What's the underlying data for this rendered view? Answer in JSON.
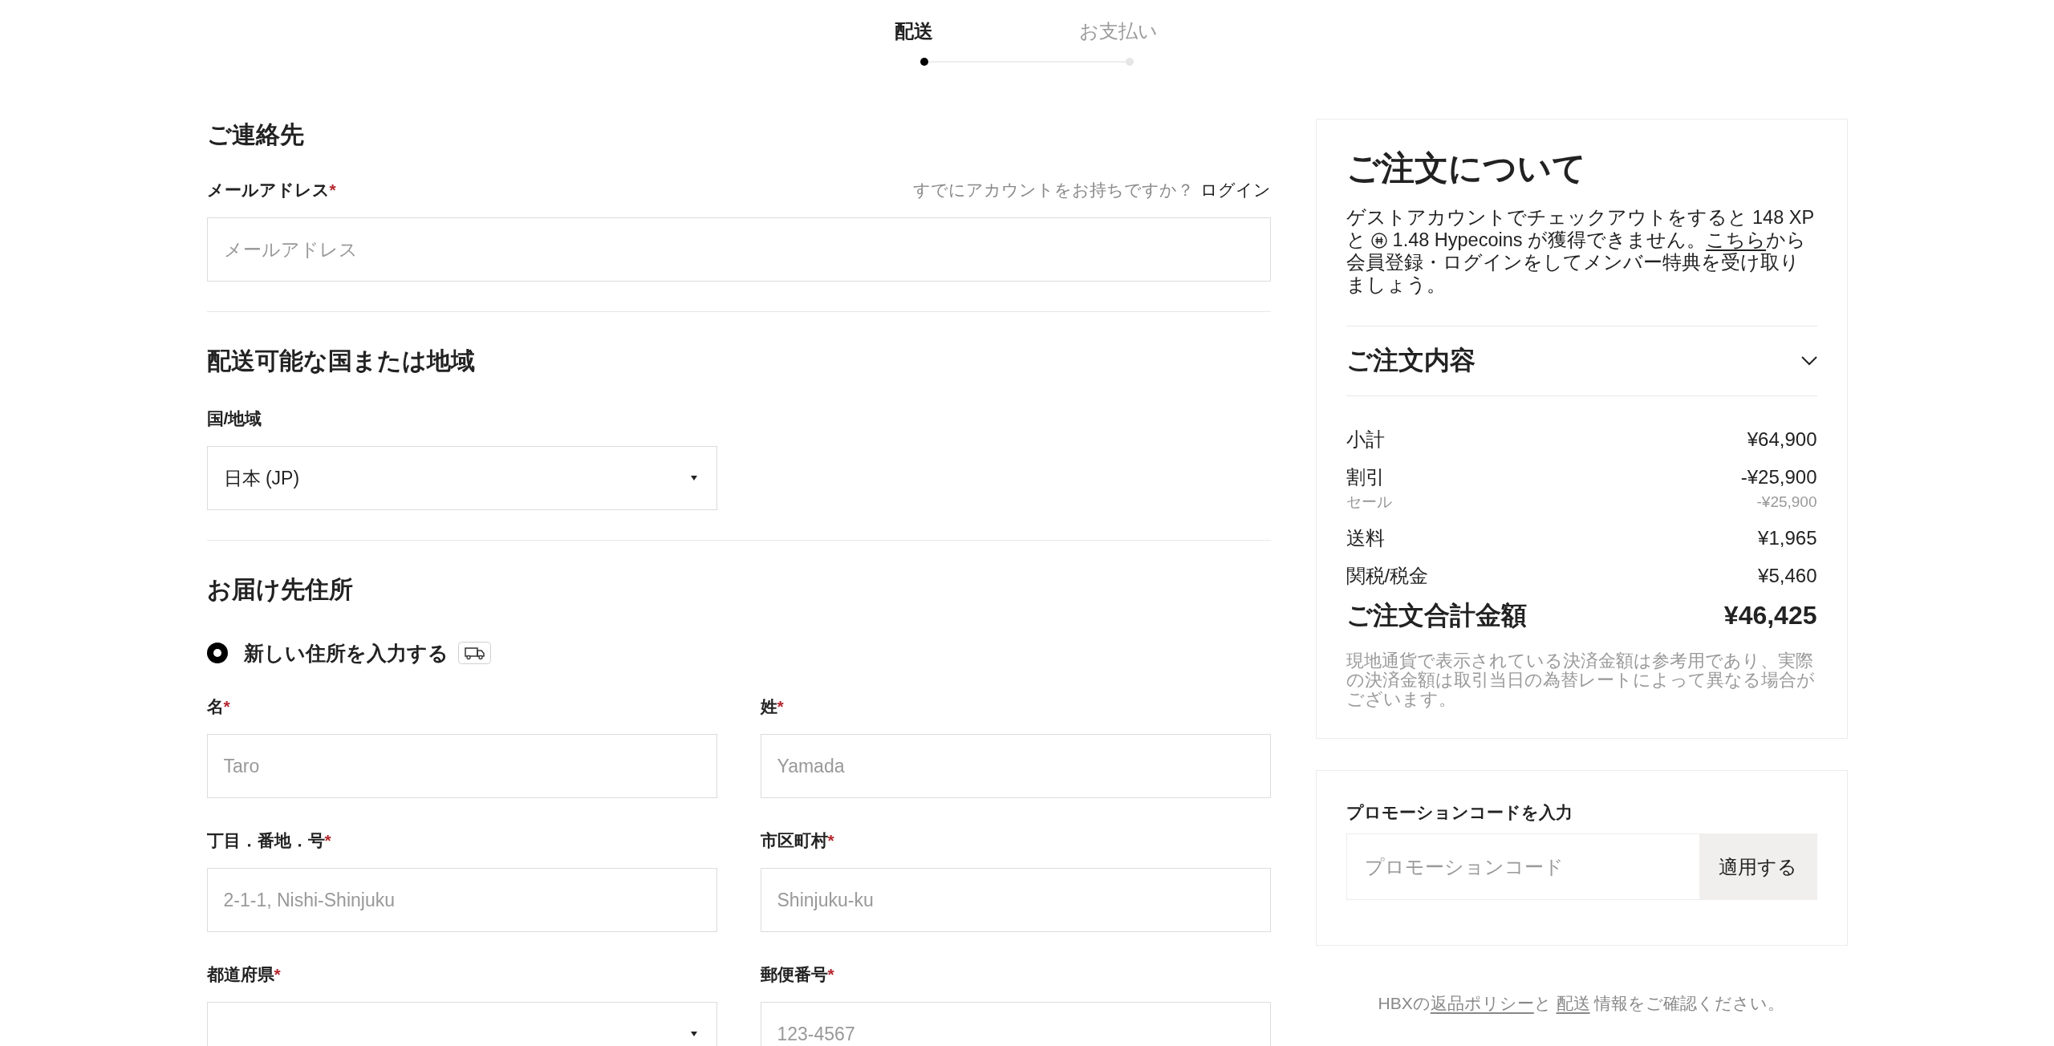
{
  "stepper": {
    "steps": [
      {
        "label": "配送",
        "selected": true
      },
      {
        "label": "お支払い",
        "selected": false
      }
    ]
  },
  "contact": {
    "heading": "ご連絡先",
    "email": {
      "label": "メールアドレス",
      "required_mark": "*",
      "placeholder": "メールアドレス"
    },
    "login_prompt": "すでにアカウントをお持ちですか？",
    "login_link": "ログイン"
  },
  "shipping_region": {
    "heading": "配送可能な国または地域",
    "country": {
      "kind": "select",
      "label": "国/地域",
      "value": "日本 (JP)"
    }
  },
  "address": {
    "heading": "お届け先住所",
    "option": {
      "label": "新しい住所を入力する",
      "selected": true
    },
    "fields": [
      {
        "kind": "text",
        "label": "名",
        "required_mark": "*",
        "placeholder": "Taro"
      },
      {
        "kind": "text",
        "label": "姓",
        "required_mark": "*",
        "placeholder": "Yamada"
      },
      {
        "kind": "text",
        "label": "丁目．番地．号",
        "required_mark": "*",
        "placeholder": "2-1-1, Nishi-Shinjuku"
      },
      {
        "kind": "text",
        "label": "市区町村",
        "required_mark": "*",
        "placeholder": "Shinjuku-ku"
      },
      {
        "kind": "select",
        "label": "都道府県",
        "required_mark": "*"
      },
      {
        "kind": "text",
        "label": "郵便番号",
        "required_mark": "*",
        "placeholder": "123-4567"
      }
    ]
  },
  "summary": {
    "title": "ご注文について",
    "notice": {
      "text_before": "ゲストアカウントでチェックアウトをすると 148 XP と",
      "text_after_icon": "1.48 Hypecoins が獲得できません。",
      "link": "こちら",
      "text_after_link": "から会員登録・ログインをしてメンバー特典を受け取りましょう。"
    },
    "order_contents": {
      "label": "ご注文内容",
      "expanded": false
    },
    "rows": [
      {
        "kind": "line",
        "label": "小計",
        "value": "¥64,900"
      },
      {
        "kind": "line",
        "label": "割引",
        "value": "-¥25,900"
      },
      {
        "kind": "sub",
        "label": "セール",
        "value": "-¥25,900"
      },
      {
        "kind": "line",
        "label": "送料",
        "value": "¥1,965"
      },
      {
        "kind": "line",
        "label": "関税/税金",
        "value": "¥5,460"
      }
    ],
    "total": {
      "label": "ご注文合計金額",
      "value": "¥46,425"
    },
    "note": "現地通貨で表示されている決済金額は参考用であり、実際の決済金額は取引当日の為替レートによって異なる場合がございます。"
  },
  "promo": {
    "label": "プロモーションコードを入力",
    "placeholder": "プロモーションコード",
    "button": "適用する"
  },
  "footer": {
    "text_before": "HBXの",
    "link_1": "返品ポリシー",
    "text_middle": "と",
    "link_2": "配送",
    "text_after": "情報をご確認ください。"
  }
}
